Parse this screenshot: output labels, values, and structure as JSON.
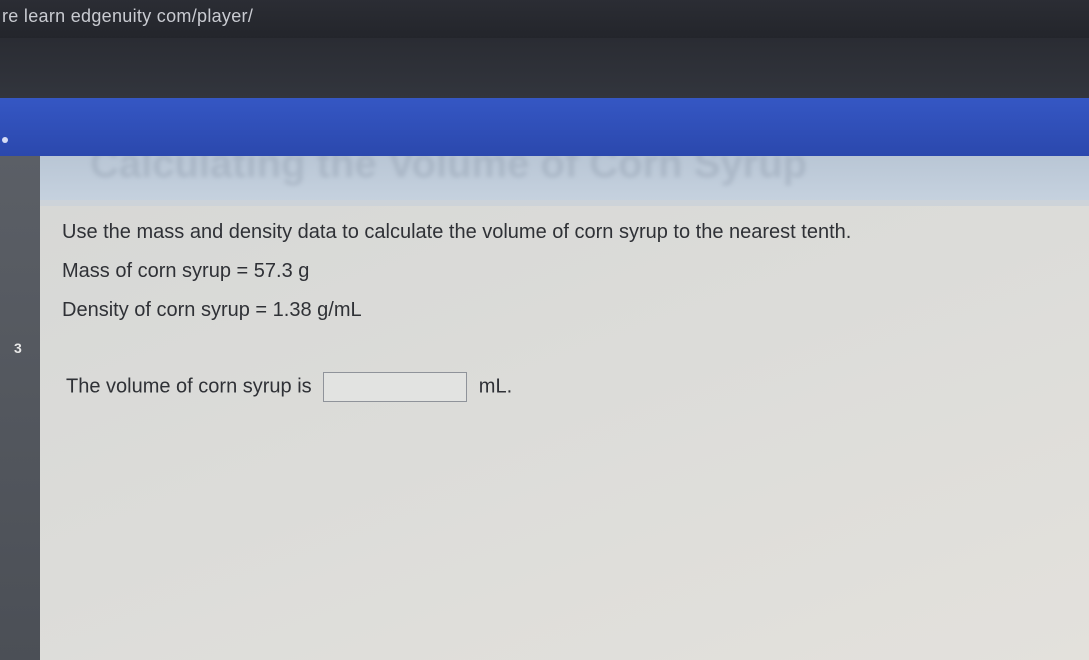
{
  "browser": {
    "url": "re learn edgenuity com/player/"
  },
  "lesson": {
    "title": "Calculating the Volume of Corn Syrup"
  },
  "question": {
    "instruction": "Use the mass and density data to calculate the volume of corn syrup to the nearest tenth.",
    "mass_label": "Mass of corn syrup",
    "mass_eq": "=",
    "mass_value": "57.3 g",
    "density_label": "Density of corn syrup",
    "density_eq": "=",
    "density_value": "1.38 g/mL",
    "answer_prefix": "The volume of corn syrup is",
    "answer_value": "",
    "answer_unit": "mL."
  },
  "rail": {
    "marks": [
      "3"
    ]
  },
  "colors": {
    "header_blue": "#3557c4",
    "content_bg": "#d9d9d7",
    "text": "#2f3136"
  }
}
